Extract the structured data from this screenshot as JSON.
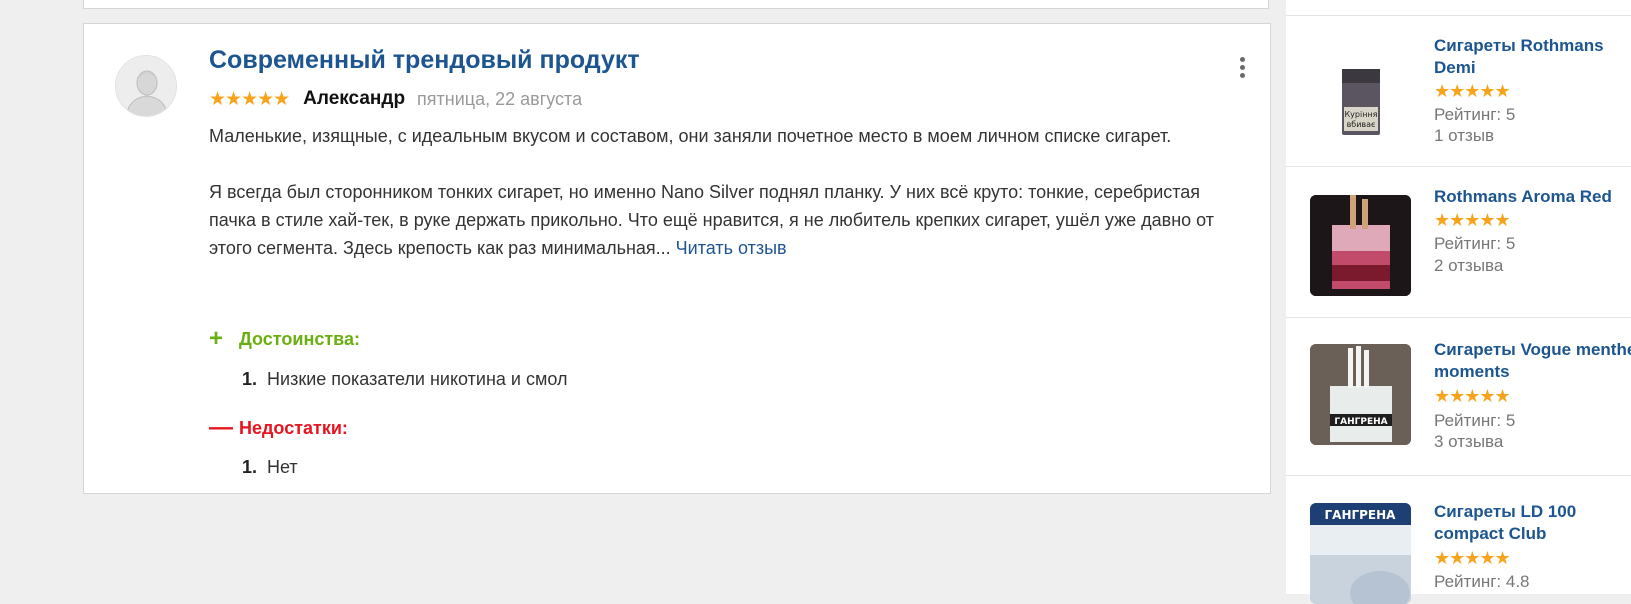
{
  "review": {
    "title": "Современный трендовый продукт",
    "stars": "★★★★★",
    "author": "Александр",
    "date": "пятница, 22 августа",
    "paragraph1": "Маленькие, изящные, с идеальным вкусом и составом, они заняли почетное место в моем личном списке сигарет.",
    "paragraph2": "Я всегда был сторонником тонких сигарет, но именно Nano Silver поднял планку. У них всё круто: тонкие, серебристая пачка в стиле хай-тек, в руке держать прикольно. Что ещё нравится, я не любитель крепких сигарет, ушёл уже давно от этого сегмента. Здесь крепость как раз минимальная...",
    "read_more": "Читать отзыв",
    "pros_sign": "+",
    "pros_title": "Достоинства:",
    "pros": [
      {
        "num": "1.",
        "text": "Низкие показатели никотина и смол"
      }
    ],
    "cons_sign": "—",
    "cons_title": "Недостатки:",
    "cons": [
      {
        "num": "1.",
        "text": "Нет"
      }
    ],
    "menu_icon": "more-vertical-icon"
  },
  "sidebar": {
    "items": [
      {
        "name_line1": "Сигареты Rothmans",
        "name_line2": "Demi",
        "stars": "★★★★★",
        "rating": "Рейтинг: 5",
        "count": "1 отзыв"
      },
      {
        "name_line1": "Rothmans Aroma Red",
        "name_line2": "",
        "stars": "★★★★★",
        "rating": "Рейтинг: 5",
        "count": "2 отзыва"
      },
      {
        "name_line1": "Сигареты Vogue menthe",
        "name_line2": "moments",
        "stars": "★★★★★",
        "rating": "Рейтинг: 5",
        "count": "3 отзыва"
      },
      {
        "name_line1": "Сигареты LD 100",
        "name_line2": "compact Club",
        "stars": "★★★★★",
        "rating": "Рейтинг: 4.8",
        "count": ""
      }
    ]
  },
  "thumbnails": {
    "item1_label_top": "Куріння",
    "item1_label_bottom": "вбиває",
    "item3_label": "ГАНГРЕНА",
    "item4_label": "ГАНГРЕНА"
  },
  "colors": {
    "link": "#1c5590",
    "star": "#f7a31b",
    "pros": "#6aaf10",
    "cons": "#e8141e"
  }
}
